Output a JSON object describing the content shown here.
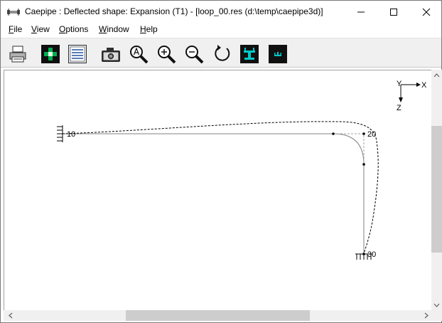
{
  "window": {
    "title": "Caepipe : Deflected shape: Expansion (T1) -  [loop_00.res (d:\\temp\\caepipe3d)]"
  },
  "menu": {
    "items": [
      {
        "key": "F",
        "rest": "ile"
      },
      {
        "key": "V",
        "rest": "iew"
      },
      {
        "key": "O",
        "rest": "ptions"
      },
      {
        "key": "W",
        "rest": "indow"
      },
      {
        "key": "H",
        "rest": "elp"
      }
    ]
  },
  "toolbar": {
    "tools": [
      "print-icon",
      "add-icon",
      "list-icon",
      "camera-icon",
      "zoom-all-icon",
      "zoom-in-icon",
      "zoom-out-icon",
      "rotate-icon",
      "view-support-icon",
      "view-node-icon"
    ]
  },
  "axes": {
    "y": "Y",
    "x": "X",
    "z": "Z"
  },
  "nodes": {
    "n10": "10",
    "n20": "20",
    "n30": "30"
  },
  "colors": {
    "icon_green": "#00b050",
    "icon_cyan": "#00c8c8",
    "icon_dark": "#101010",
    "pipe_line": "#808080",
    "deflected": "#000000"
  }
}
